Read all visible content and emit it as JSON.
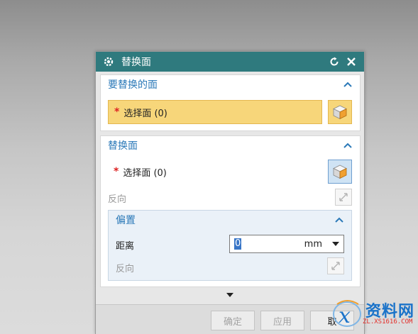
{
  "dialog": {
    "title": "替换面"
  },
  "group_face_to_replace": {
    "header": "要替换的面",
    "select_label": "选择面 (0)"
  },
  "group_replacement_face": {
    "header": "替换面",
    "select_label": "选择面 (0)",
    "reverse_label": "反向"
  },
  "offset_group": {
    "header": "偏置",
    "distance_label": "距离",
    "distance_value": "0",
    "distance_unit": "mm",
    "reverse_label": "反向"
  },
  "footer": {
    "ok_label": "确定",
    "apply_label": "应用",
    "cancel_label": "取"
  },
  "watermark": {
    "text": "资料网",
    "url": "ZL.XS1616.COM"
  },
  "colors": {
    "titlebar": "#2f7a7e",
    "header_text": "#2b79b8",
    "active_selection": "#f7d67a",
    "required_asterisk": "#dd2222"
  },
  "icons": {
    "title": "gear-icon",
    "reset": "reset-icon",
    "close": "close-icon",
    "collapse": "chevron-up-icon",
    "face_select": "cube-icon",
    "reverse": "reverse-direction-icon",
    "dropdown": "caret-down-icon",
    "expand": "triangle-down-icon"
  }
}
